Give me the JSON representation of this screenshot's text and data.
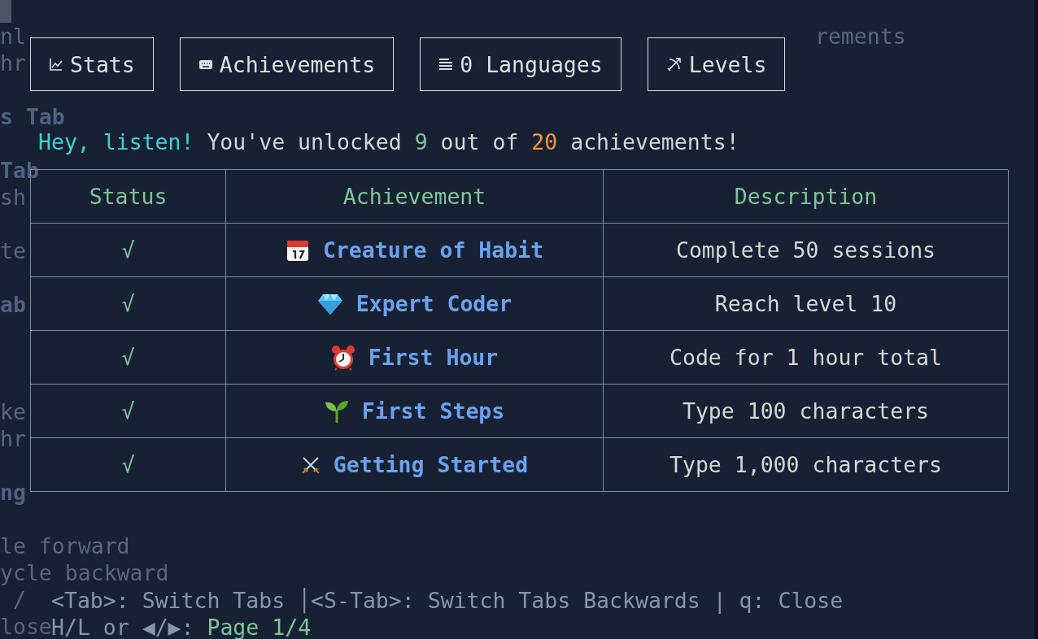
{
  "background_text": [
    {
      "text": "nl",
      "kind": "text"
    },
    {
      "text": "rements",
      "kind": "text"
    },
    {
      "text": "hr",
      "kind": "text"
    },
    {
      "text": "s Tab",
      "kind": "heading"
    },
    {
      "text": "Tab",
      "kind": "heading"
    },
    {
      "text": "sh",
      "kind": "text"
    },
    {
      "text": "te",
      "kind": "text"
    },
    {
      "text": "ab",
      "kind": "heading"
    },
    {
      "text": "ke",
      "kind": "text"
    },
    {
      "text": "hr",
      "kind": "text"
    },
    {
      "text": "ng",
      "kind": "heading"
    },
    {
      "text": "le forward",
      "kind": "text"
    },
    {
      "text": "ycle backward",
      "kind": "text"
    },
    {
      "text": "/",
      "kind": "text"
    },
    {
      "text": "lose",
      "kind": "text"
    }
  ],
  "tabs": [
    {
      "label": "Stats",
      "kind": "chart"
    },
    {
      "label": "Achievements",
      "kind": "keyboard"
    },
    {
      "label": "0 Languages",
      "kind": "list"
    },
    {
      "label": "Levels",
      "kind": "bow"
    }
  ],
  "message": [
    {
      "text": "Hey, listen!",
      "kind": "accent"
    },
    {
      "text": " You've unlocked ",
      "kind": "plain"
    },
    {
      "text": "9",
      "kind": "good"
    },
    {
      "text": " out of ",
      "kind": "plain"
    },
    {
      "text": "20",
      "kind": "warn"
    },
    {
      "text": " achievements!",
      "kind": "plain"
    }
  ],
  "table": {
    "columns": [
      "Status",
      "Achievement",
      "Description"
    ],
    "rows": [
      {
        "status": "√",
        "kind": "calendar",
        "name": "Creature of Habit",
        "description": "Complete 50 sessions"
      },
      {
        "status": "√",
        "kind": "gem",
        "name": "Expert Coder",
        "description": "Reach level 10"
      },
      {
        "status": "√",
        "kind": "clock",
        "name": "First Hour",
        "description": "Code for 1 hour total"
      },
      {
        "status": "√",
        "kind": "sprout",
        "name": "First Steps",
        "description": "Type 100 characters"
      },
      {
        "status": "√",
        "kind": "swords",
        "name": "Getting Started",
        "description": "Type 1,000 characters"
      }
    ]
  },
  "footer": {
    "keys": "<Tab>: Switch Tabs │<S-Tab>: Switch Tabs Backwards | q: Close",
    "paging": "H/L or ◀/▶: ",
    "page": "Page 1/4"
  }
}
